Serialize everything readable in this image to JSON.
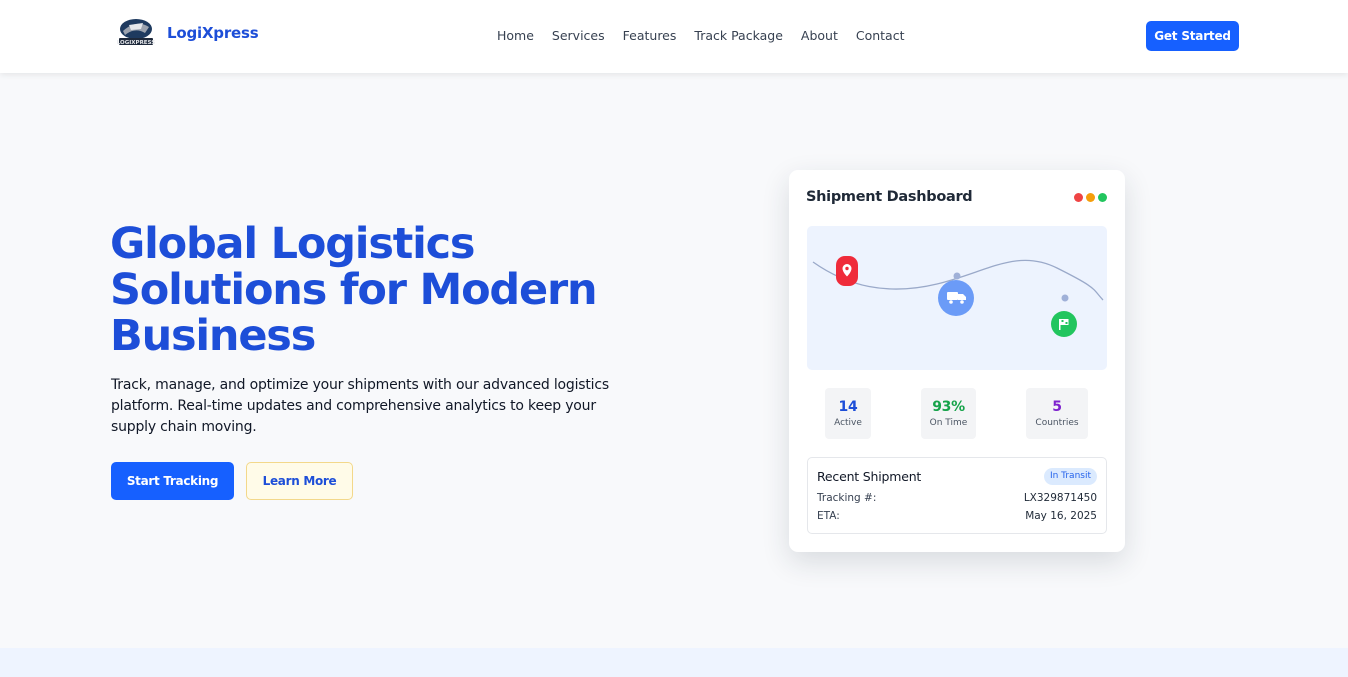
{
  "brand": {
    "name": "LogiXpress",
    "logo_text": "LOGIXPRESS"
  },
  "nav": {
    "links": [
      "Home",
      "Services",
      "Features",
      "Track Package",
      "About",
      "Contact"
    ],
    "cta": "Get Started"
  },
  "hero": {
    "title_lines": [
      "Global Logistics",
      "Solutions for Modern",
      "Business"
    ],
    "description_lines": [
      "Track, manage, and optimize your shipments with our advanced logistics",
      "platform. Real-time updates and comprehensive analytics to keep your",
      "supply chain moving."
    ],
    "primary_button": "Start Tracking",
    "secondary_button": "Learn More"
  },
  "dashboard": {
    "title": "Shipment Dashboard",
    "window_dots": [
      "#ef4444",
      "#f59e0b",
      "#22c55e"
    ],
    "map_icons": [
      "location-pin-icon",
      "truck-icon",
      "flag-icon"
    ],
    "stats": [
      {
        "value": "14",
        "label": "Active",
        "color": "#1d4ed8"
      },
      {
        "value": "93%",
        "label": "On Time",
        "color": "#16a34a"
      },
      {
        "value": "5",
        "label": "Countries",
        "color": "#7e22ce"
      }
    ],
    "recent": {
      "title": "Recent Shipment",
      "status": "In Transit",
      "tracking_label": "Tracking #:",
      "tracking_value": "LX329871450",
      "eta_label": "ETA:",
      "eta_value": "May 16, 2025"
    }
  },
  "colors": {
    "primary": "#1660ff",
    "heading": "#1d4ed8",
    "secondary_bg": "#fffbe8"
  }
}
